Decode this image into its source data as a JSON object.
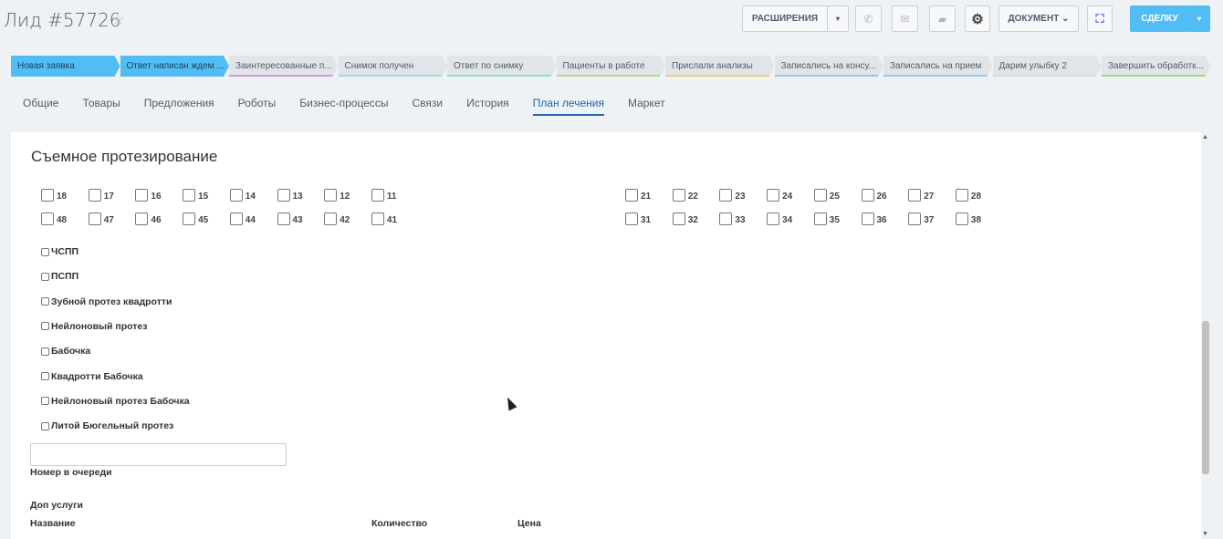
{
  "header": {
    "title": "Лид #57726",
    "extensions": "РАСШИРЕНИЯ",
    "document": "ДОКУМЕНТ",
    "deal": "СДЕЛКУ"
  },
  "stages": [
    {
      "label": "Новая заявка",
      "active": true,
      "color": ""
    },
    {
      "label": "Ответ написан ждем ...",
      "active": true,
      "color": ""
    },
    {
      "label": "Заинтересованные п...",
      "active": false,
      "color": "#c8a0d8"
    },
    {
      "label": "Снимок получен",
      "active": false,
      "color": "#9fdbe8"
    },
    {
      "label": "Ответ по снимку",
      "active": false,
      "color": "#8fe0c8"
    },
    {
      "label": "Пациенты в работе",
      "active": false,
      "color": "#b5dc8a"
    },
    {
      "label": "Прислали анализы",
      "active": false,
      "color": "#f0d070"
    },
    {
      "label": "Записались на консу...",
      "active": false,
      "color": "#9cc3ea"
    },
    {
      "label": "Записались на прием",
      "active": false,
      "color": "#8ccaf0"
    },
    {
      "label": "Дарим улыбку 2",
      "active": false,
      "color": "#d5d9de"
    },
    {
      "label": "Завершить обработк...",
      "active": false,
      "color": "#9fd87a"
    }
  ],
  "tabs": [
    {
      "label": "Общие"
    },
    {
      "label": "Товары"
    },
    {
      "label": "Предложения"
    },
    {
      "label": "Роботы"
    },
    {
      "label": "Бизнес-процессы"
    },
    {
      "label": "Связи"
    },
    {
      "label": "История"
    },
    {
      "label": "План лечения",
      "active": true
    },
    {
      "label": "Маркет"
    }
  ],
  "section": {
    "title": "Съемное протезирование",
    "teeth_left_top": [
      "18",
      "17",
      "16",
      "15",
      "14",
      "13",
      "12",
      "11"
    ],
    "teeth_left_bottom": [
      "48",
      "47",
      "46",
      "45",
      "44",
      "43",
      "42",
      "41"
    ],
    "teeth_right_top": [
      "21",
      "22",
      "23",
      "24",
      "25",
      "26",
      "27",
      "28"
    ],
    "teeth_right_bottom": [
      "31",
      "32",
      "33",
      "34",
      "35",
      "36",
      "37",
      "38"
    ],
    "options": [
      "ЧСПП",
      "ПСПП",
      "Зубной протез квадротти",
      "Нейлоновый протез",
      "Бабочка",
      "Квадротти Бабочка",
      "Нейлоновый протез Бабочка",
      "Литой Бюгельный протез"
    ],
    "queue_label": "Номер в очереди",
    "extra_label": "Доп услуги",
    "col_name": "Название",
    "col_qty": "Количество",
    "col_price": "Цена"
  }
}
